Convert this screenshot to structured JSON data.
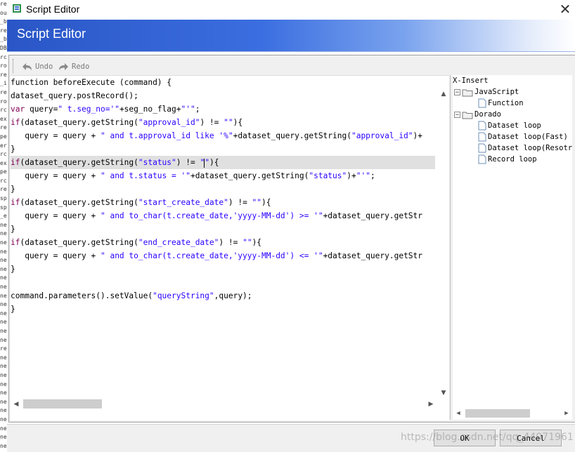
{
  "window": {
    "title": "Script Editor",
    "close_glyph": "✕"
  },
  "banner": {
    "title": "Script Editor"
  },
  "toolbar": {
    "undo_label": "Undo",
    "redo_label": "Redo"
  },
  "editor": {
    "lines": [
      "function beforeExecute (command) {",
      "dataset_query.postRecord();",
      "var query=\" t.seg_no='\"+seg_no_flag+\"'\";",
      "if(dataset_query.getString(\"approval_id\") != \"\"){",
      "   query = query + \" and t.approval_id like '%\"+dataset_query.getString(\"approval_id\")+",
      "}",
      "if(dataset_query.getString(\"status\") != \"\"){",
      "   query = query + \" and t.status = '\"+dataset_query.getString(\"status\")+\"'\";",
      "}",
      "if(dataset_query.getString(\"start_create_date\") != \"\"){",
      "   query = query + \" and to_char(t.create_date,'yyyy-MM-dd') >= '\"+dataset_query.getStr",
      "}",
      "if(dataset_query.getString(\"end_create_date\") != \"\"){",
      "   query = query + \" and to_char(t.create_date,'yyyy-MM-dd') <= '\"+dataset_query.getStr",
      "}",
      "",
      "command.parameters().setValue(\"queryString\",query);",
      "}"
    ],
    "highlighted_line": 6
  },
  "xinsert": {
    "title": "X-Insert",
    "groups": [
      {
        "label": "JavaScript",
        "expander": "−",
        "items": [
          "Function"
        ]
      },
      {
        "label": "Dorado",
        "expander": "−",
        "items": [
          "Dataset loop",
          "Dataset loop(Fast)",
          "Dataset loop(Resotr",
          "Record loop"
        ]
      }
    ]
  },
  "buttons": {
    "ok_label": "OK",
    "cancel_label": "Cancel"
  },
  "watermark": "https://blog.csdn.net/qq_44071961",
  "background_strip": [
    "re",
    "ou",
    "_b",
    "re",
    "_b",
    "DB",
    "rc",
    "ro",
    "re",
    "_i",
    "re",
    "ro",
    "rc",
    "ex",
    "re",
    "pe",
    "er",
    "rc",
    "ex",
    "pe",
    "rc",
    "re",
    "sp",
    "sp",
    "_e",
    "ne",
    "ne",
    "ne",
    "ne",
    "ne",
    "ne",
    "ne",
    "ne",
    "ne",
    "ne",
    "ne",
    "ne",
    "ne",
    "ne",
    "re",
    "ne",
    "ne",
    "ne",
    "ne",
    "ne",
    "ne",
    "ne",
    "ne",
    "ne",
    "ne",
    "ne"
  ],
  "colors": {
    "keyword": "#7f0055",
    "string": "#2a00ff",
    "banner_start": "#2a56c6",
    "banner_end": "#ffffff",
    "highlight": "#e0e0e0"
  }
}
